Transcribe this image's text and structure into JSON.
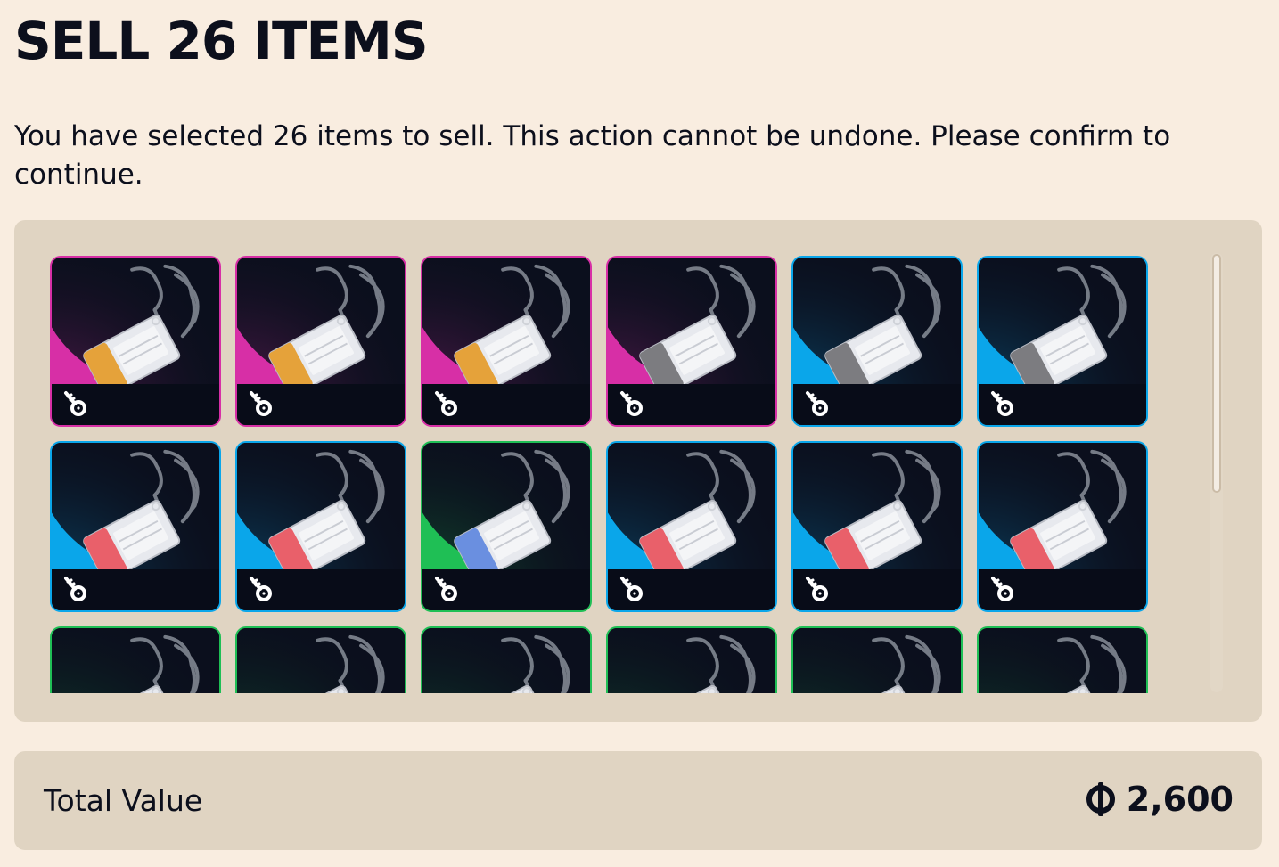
{
  "header": {
    "title": "SELL 26 ITEMS",
    "description": "You have selected 26 items to sell. This action cannot be undone. Please confirm to continue."
  },
  "items": [
    {
      "rarity": "pink",
      "color": "#d72fa6",
      "tag": "#e5a23a",
      "icon": "key-icon"
    },
    {
      "rarity": "pink",
      "color": "#d72fa6",
      "tag": "#e5a23a",
      "icon": "key-icon"
    },
    {
      "rarity": "pink",
      "color": "#d72fa6",
      "tag": "#e5a23a",
      "icon": "key-icon"
    },
    {
      "rarity": "pink",
      "color": "#d72fa6",
      "tag": "#7c7c80",
      "icon": "key-icon"
    },
    {
      "rarity": "blue",
      "color": "#0aa6ea",
      "tag": "#7c7c80",
      "icon": "key-icon"
    },
    {
      "rarity": "blue",
      "color": "#0aa6ea",
      "tag": "#7c7c80",
      "icon": "key-icon"
    },
    {
      "rarity": "blue",
      "color": "#0aa6ea",
      "tag": "#e9606a",
      "icon": "key-icon"
    },
    {
      "rarity": "blue",
      "color": "#0aa6ea",
      "tag": "#e9606a",
      "icon": "key-icon"
    },
    {
      "rarity": "green",
      "color": "#1fbf55",
      "tag": "#6a8fe0",
      "icon": "key-icon"
    },
    {
      "rarity": "blue",
      "color": "#0aa6ea",
      "tag": "#e9606a",
      "icon": "key-icon"
    },
    {
      "rarity": "blue",
      "color": "#0aa6ea",
      "tag": "#e9606a",
      "icon": "key-icon"
    },
    {
      "rarity": "blue",
      "color": "#0aa6ea",
      "tag": "#e9606a",
      "icon": "key-icon"
    },
    {
      "rarity": "green",
      "color": "#1fbf55",
      "tag": "#7c7c80",
      "icon": "key-icon"
    },
    {
      "rarity": "green",
      "color": "#1fbf55",
      "tag": "#7c7c80",
      "icon": "key-icon"
    },
    {
      "rarity": "green",
      "color": "#1fbf55",
      "tag": "#7c7c80",
      "icon": "key-icon"
    },
    {
      "rarity": "green",
      "color": "#1fbf55",
      "tag": "#7c7c80",
      "icon": "key-icon"
    },
    {
      "rarity": "green",
      "color": "#1fbf55",
      "tag": "#7c7c80",
      "icon": "key-icon"
    },
    {
      "rarity": "green",
      "color": "#1fbf55",
      "tag": "#7c7c80",
      "icon": "key-icon"
    }
  ],
  "total": {
    "label": "Total Value",
    "currency_icon": "coin-icon",
    "amount": "2,600"
  },
  "colors": {
    "background": "#f9ede0",
    "panel": "#e0d4c2",
    "text": "#0c0f1c",
    "card_dark": "#0b0f1d"
  }
}
